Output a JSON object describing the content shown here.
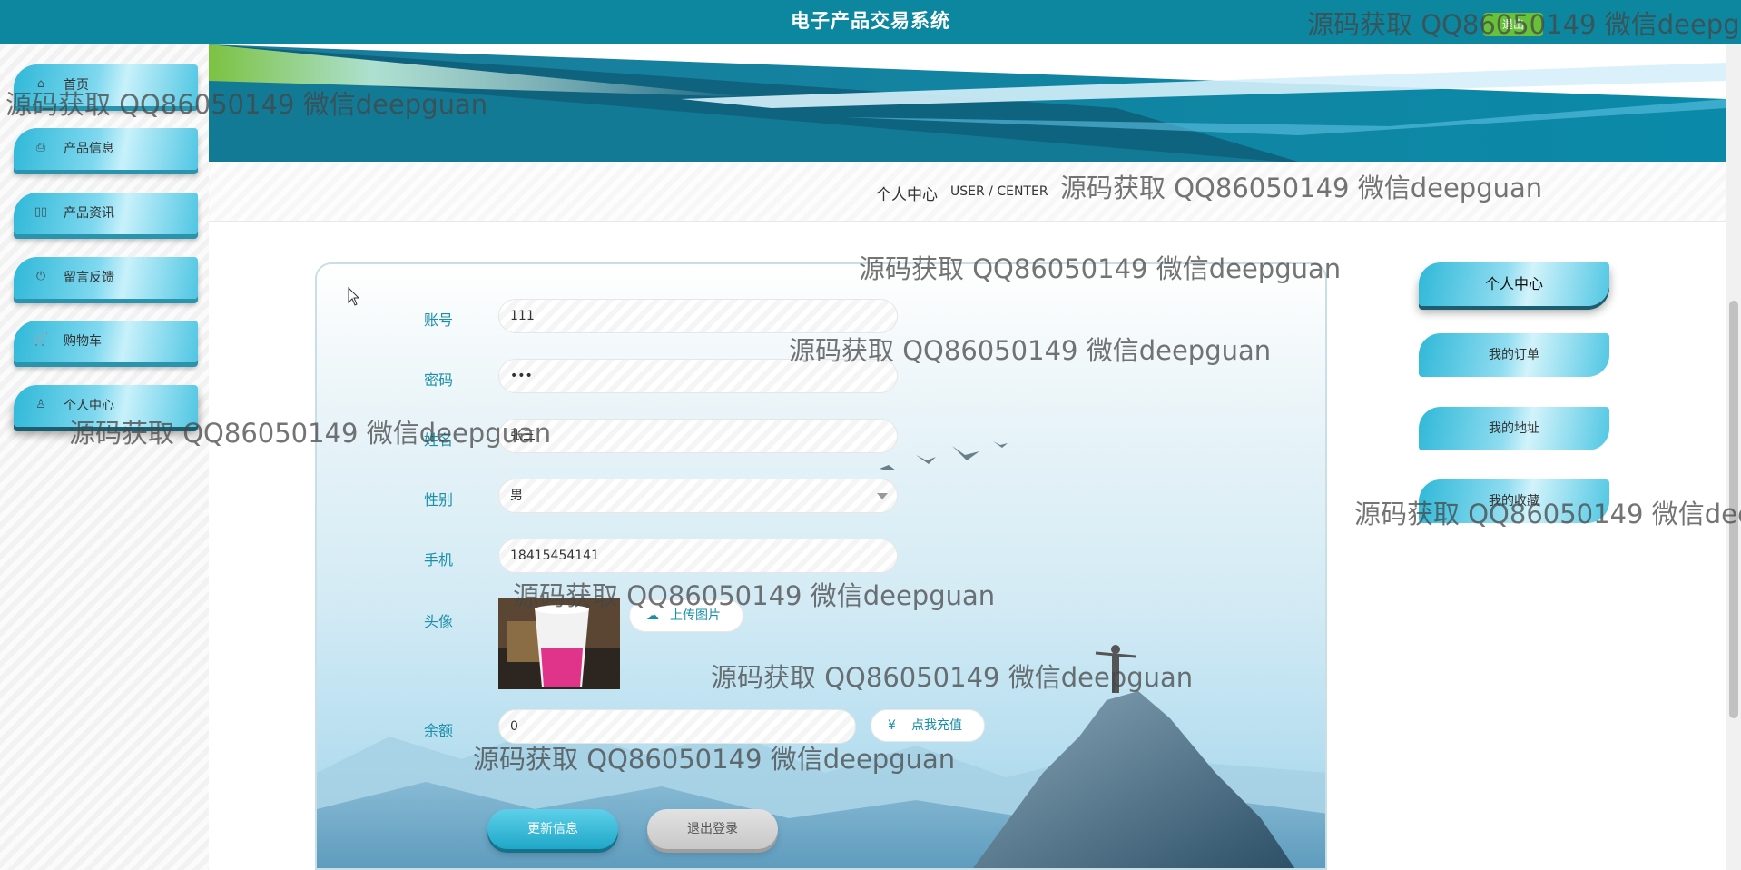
{
  "header": {
    "title": "电子产品交易系统",
    "logout_label": "退出"
  },
  "sidebar": {
    "items": [
      {
        "label": "首页",
        "icon": "home-icon"
      },
      {
        "label": "产品信息",
        "icon": "printer-icon"
      },
      {
        "label": "产品资讯",
        "icon": "book-icon"
      },
      {
        "label": "留言反馈",
        "icon": "power-icon"
      },
      {
        "label": "购物车",
        "icon": "cart-icon"
      },
      {
        "label": "个人中心",
        "icon": "user-icon"
      }
    ],
    "active": "个人中心"
  },
  "section": {
    "title_zh": "个人中心",
    "title_en": "USER / CENTER"
  },
  "form": {
    "account_label": "账号",
    "account_value": "111",
    "password_label": "密码",
    "password_value": "•••",
    "name_label": "姓名",
    "name_value": "张三",
    "gender_label": "性别",
    "gender_value": "男",
    "phone_label": "手机",
    "phone_value": "18415454141",
    "avatar_label": "头像",
    "upload_label": "上传图片",
    "balance_label": "余额",
    "balance_value": "0",
    "recharge_label": "点我充值",
    "update_label": "更新信息",
    "logout_label": "退出登录"
  },
  "right_menu": {
    "items": [
      "个人中心",
      "我的订单",
      "我的地址",
      "我的收藏"
    ],
    "active": "个人中心"
  },
  "watermark": "源码获取 QQ86050149 微信deepguan",
  "colors": {
    "topbar": "#0d879f",
    "accent": "#1b8fa8",
    "logout_button": "#67c23a"
  }
}
